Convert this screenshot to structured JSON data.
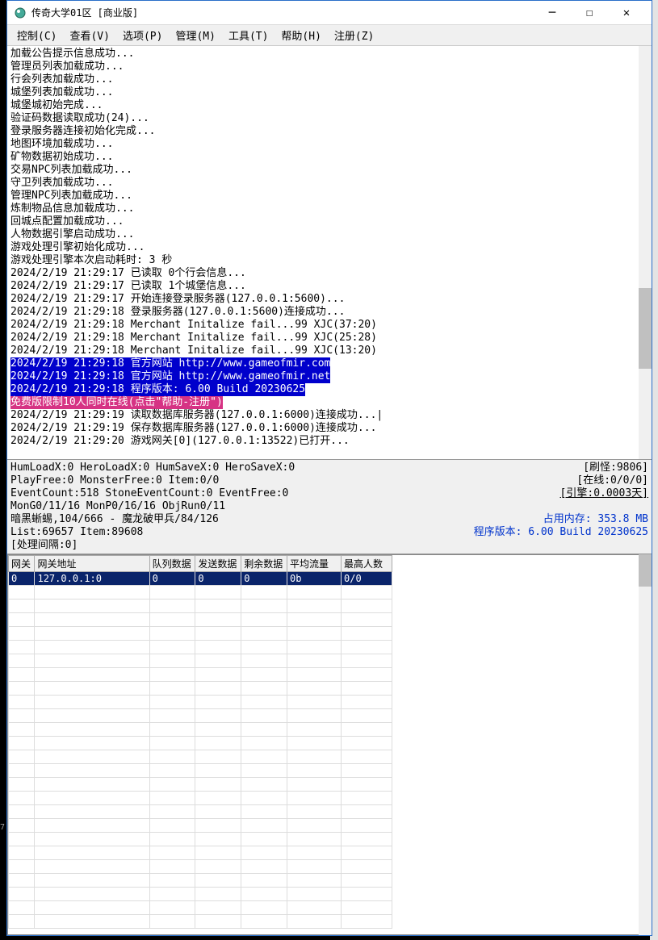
{
  "window": {
    "title": "传奇大学01区 [商业版]"
  },
  "menu": {
    "control": "控制(C)",
    "view": "查看(V)",
    "options": "选项(P)",
    "manage": "管理(M)",
    "tools": "工具(T)",
    "help": "帮助(H)",
    "register": "注册(Z)"
  },
  "log_lines": [
    {
      "t": "加载公告提示信息成功..."
    },
    {
      "t": "管理员列表加载成功..."
    },
    {
      "t": "行会列表加载成功..."
    },
    {
      "t": "城堡列表加载成功..."
    },
    {
      "t": "城堡城初始完成..."
    },
    {
      "t": "验证码数据读取成功(24)..."
    },
    {
      "t": "登录服务器连接初始化完成..."
    },
    {
      "t": "地图环境加载成功..."
    },
    {
      "t": "矿物数据初始成功..."
    },
    {
      "t": "交易NPC列表加载成功..."
    },
    {
      "t": "守卫列表加载成功..."
    },
    {
      "t": "管理NPC列表加载成功..."
    },
    {
      "t": "炼制物品信息加载成功..."
    },
    {
      "t": "回城点配置加载成功..."
    },
    {
      "t": "人物数据引擎启动成功..."
    },
    {
      "t": "游戏处理引擎初始化成功..."
    },
    {
      "t": "游戏处理引擎本次启动耗时: 3 秒"
    },
    {
      "t": "2024/2/19 21:29:17 已读取 0个行会信息..."
    },
    {
      "t": "2024/2/19 21:29:17 已读取 1个城堡信息..."
    },
    {
      "t": "2024/2/19 21:29:17 开始连接登录服务器(127.0.0.1:5600)..."
    },
    {
      "t": "2024/2/19 21:29:18 登录服务器(127.0.0.1:5600)连接成功..."
    },
    {
      "t": "2024/2/19 21:29:18 Merchant Initalize fail...99 XJC(37:20)"
    },
    {
      "t": "2024/2/19 21:29:18 Merchant Initalize fail...99 XJC(25:28)"
    },
    {
      "t": "2024/2/19 21:29:18 Merchant Initalize fail...99 XJC(13:20)"
    },
    {
      "t": "2024/2/19 21:29:18 官方网站 http://www.gameofmir.com",
      "c": "blue"
    },
    {
      "t": "2024/2/19 21:29:18 官方网站 http://www.gameofmir.net",
      "c": "blue"
    },
    {
      "t": "2024/2/19 21:29:18 程序版本: 6.00 Build 20230625",
      "c": "blue"
    },
    {
      "t": "免费版限制10人同时在线(点击\"帮助-注册\")",
      "c": "magenta"
    },
    {
      "t": "2024/2/19 21:29:19 读取数据库服务器(127.0.0.1:6000)连接成功...|"
    },
    {
      "t": "2024/2/19 21:29:19 保存数据库服务器(127.0.0.1:6000)连接成功..."
    },
    {
      "t": "2024/2/19 21:29:20 游戏网关[0](127.0.0.1:13522)已打开..."
    }
  ],
  "stats": {
    "l1l": "HumLoadX:0 HeroLoadX:0 HumSaveX:0 HeroSaveX:0",
    "l1r": "[刷怪:9806]",
    "l2l": "PlayFree:0 MonsterFree:0 Item:0/0",
    "l2r": "[在线:0/0/0]",
    "l3l": "EventCount:518 StoneEventCount:0 EventFree:0",
    "l3r": "[引擎:0.0003天]",
    "l4l": "MonG0/11/16 MonP0/16/16 ObjRun0/11",
    "l5l": "暗黑蜥蜴,104/666 - 魔龙破甲兵/84/126",
    "l5r": "占用内存: 353.8 MB",
    "l6l": "List:69657 Item:89608",
    "l6r": "程序版本: 6.00 Build 20230625",
    "l7l": "[处理间隔:0]"
  },
  "table": {
    "headers": [
      "网关",
      "网关地址",
      "队列数据",
      "发送数据",
      "剩余数据",
      "平均流量",
      "最高人数"
    ],
    "row": [
      "0",
      "127.0.0.1:0",
      "0",
      "0",
      "0",
      "0b",
      "0/0"
    ]
  },
  "side_num": "7."
}
